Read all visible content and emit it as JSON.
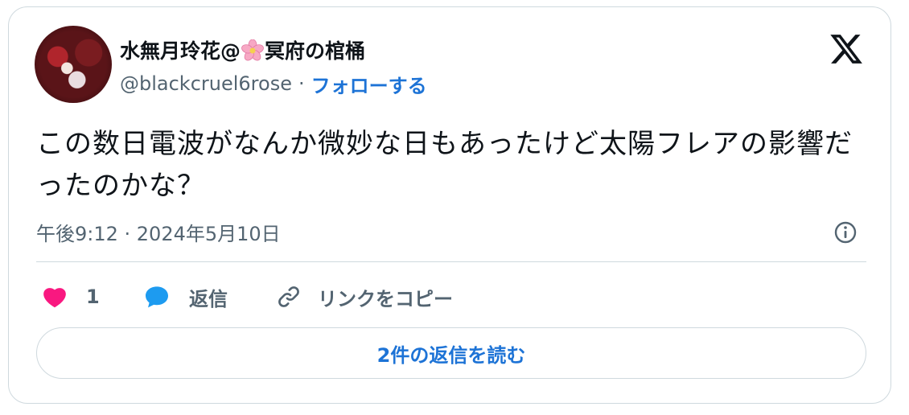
{
  "author": {
    "display_name_part1": "水無月玲花@",
    "display_name_part2": "冥府の棺桶",
    "handle": "@blackcruel6rose",
    "separator": "·",
    "follow_label": "フォローする"
  },
  "tweet": {
    "text": "この数日電波がなんか微妙な日もあったけど太陽フレアの影響だったのかな？",
    "timestamp": "午後9:12 · 2024年5月10日"
  },
  "actions": {
    "like_count": "1",
    "reply_label": "返信",
    "copy_link_label": "リンクをコピー"
  },
  "read_replies_label": "2件の返信を読む",
  "colors": {
    "accent": "#1d73d6",
    "like": "#f91880",
    "reply_icon": "#1d9bf0",
    "muted": "#536471",
    "border": "#cfd9de"
  },
  "icons": [
    "x-logo-icon",
    "cherry-blossom-icon",
    "info-icon",
    "heart-icon",
    "reply-bubble-icon",
    "link-icon"
  ]
}
